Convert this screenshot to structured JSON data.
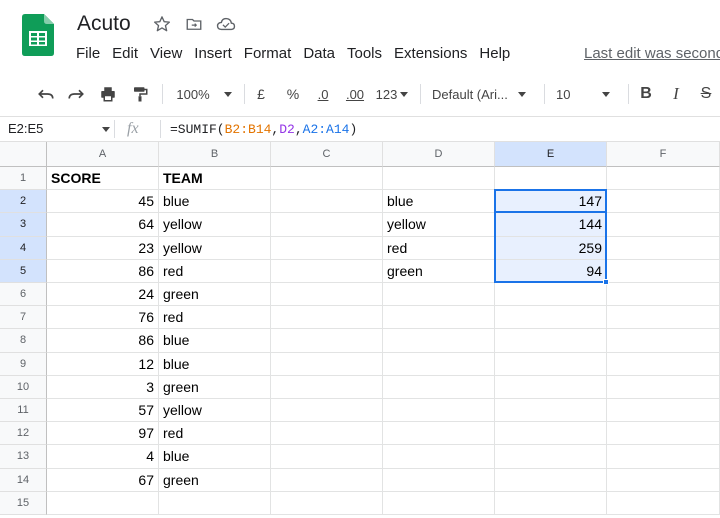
{
  "app": {
    "title": "Acuto",
    "last_edit": "Last edit was seconds ago",
    "menu": [
      "File",
      "Edit",
      "View",
      "Insert",
      "Format",
      "Data",
      "Tools",
      "Extensions",
      "Help"
    ]
  },
  "toolbar": {
    "zoom": "100%",
    "currency": "£",
    "percent": "%",
    "decrease_decimal": ".0",
    "increase_decimal": ".00",
    "more_formats": "123",
    "font": "Default (Ari...",
    "font_size": "10",
    "bold": "B",
    "italic": "I",
    "strike": "S"
  },
  "formula_bar": {
    "name_box": "E2:E5",
    "fx": "fx",
    "formula_prefix": "=SUMIF(",
    "formula_range1": "B2:B14",
    "formula_comma1": ",",
    "formula_criteria": "D2",
    "formula_comma2": ",",
    "formula_range2": "A2:A14",
    "formula_suffix": ")"
  },
  "grid": {
    "columns": [
      "A",
      "B",
      "C",
      "D",
      "E",
      "F"
    ],
    "rows": [
      "1",
      "2",
      "3",
      "4",
      "5",
      "6",
      "7",
      "8",
      "9",
      "10",
      "11",
      "12",
      "13",
      "14",
      "15"
    ],
    "cells": {
      "A1": "SCORE",
      "B1": "TEAM",
      "A2": "45",
      "B2": "blue",
      "D2": "blue",
      "E2": "147",
      "A3": "64",
      "B3": "yellow",
      "D3": "yellow",
      "E3": "144",
      "A4": "23",
      "B4": "yellow",
      "D4": "red",
      "E4": "259",
      "A5": "86",
      "B5": "red",
      "D5": "green",
      "E5": "94",
      "A6": "24",
      "B6": "green",
      "A7": "76",
      "B7": "red",
      "A8": "86",
      "B8": "blue",
      "A9": "12",
      "B9": "blue",
      "A10": "3",
      "B10": "green",
      "A11": "57",
      "B11": "yellow",
      "A12": "97",
      "B12": "red",
      "A13": "4",
      "B13": "blue",
      "A14": "67",
      "B14": "green"
    }
  },
  "colors": {
    "selection": "#1a73e8",
    "selection_fill": "#e8f0fe",
    "header_selected": "#d3e3fd",
    "sheets_green": "#0f9d58"
  }
}
